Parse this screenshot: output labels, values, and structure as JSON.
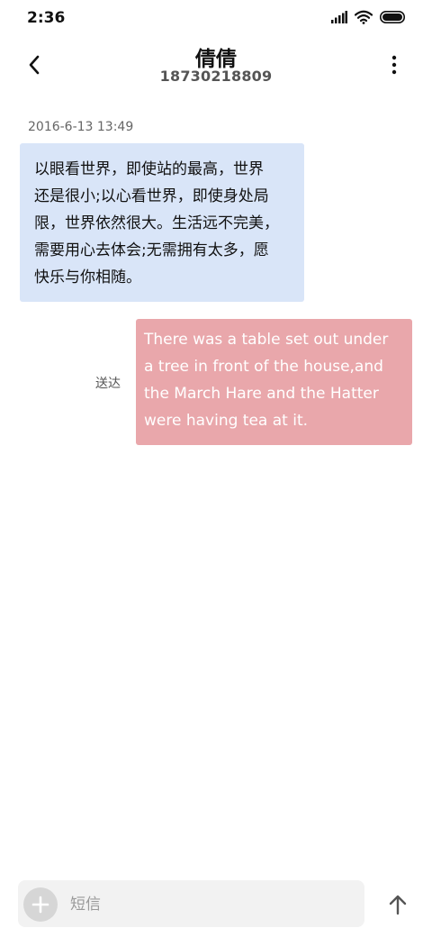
{
  "status_bar": {
    "time": "2:36"
  },
  "header": {
    "contact_name": "倩倩",
    "contact_number": "18730218809"
  },
  "conversation": {
    "timestamp": "2016-6-13 13:49",
    "messages": [
      {
        "direction": "incoming",
        "lines": [
          "以眼看世界，即使站的最高，世界",
          "还是很小;以心看世界，即使身处局",
          "限，世界依然很大。生活远不完美，",
          "需要用心去体会;无需拥有太多，愿",
          "快乐与你相随。"
        ]
      },
      {
        "direction": "outgoing",
        "status": "送达",
        "lines": [
          "There was a table set out under",
          "a tree in front of the house,and",
          "the March Hare and the Hatter",
          "were having tea at it."
        ]
      }
    ]
  },
  "composer": {
    "placeholder": "短信"
  },
  "colors": {
    "incoming_bubble": "#d9e5f8",
    "outgoing_bubble": "#e9a7ab",
    "outgoing_text": "#ffffff",
    "composer_bg": "#f2f2f2"
  },
  "icons": {
    "back": "chevron-left-icon",
    "more": "more-vertical-icon",
    "add": "plus-icon",
    "send": "arrow-up-icon",
    "signal": "signal-icon",
    "wifi": "wifi-icon",
    "battery": "battery-icon"
  }
}
